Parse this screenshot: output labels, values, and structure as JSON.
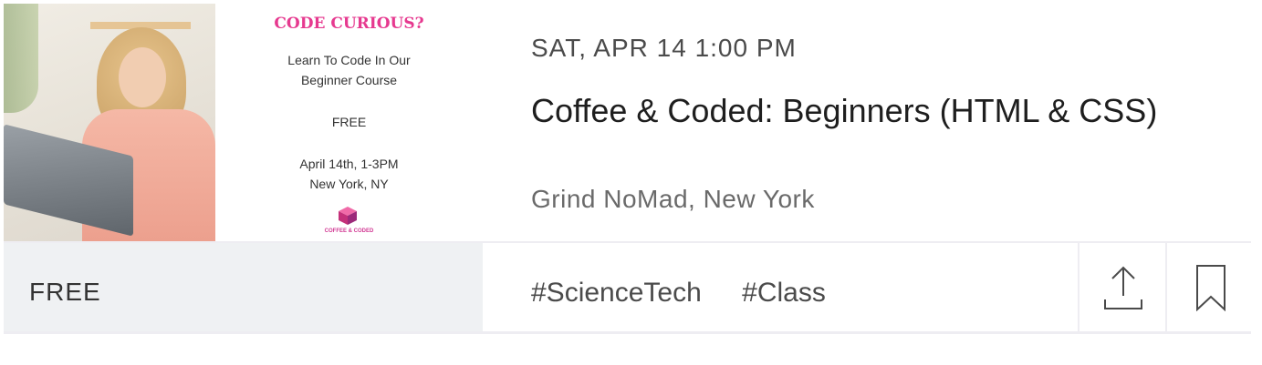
{
  "image": {
    "flyer_title": "CODE CURIOUS?",
    "flyer_line1": "Learn To Code In Our",
    "flyer_line2": "Beginner Course",
    "flyer_price": "FREE",
    "flyer_date": "April 14th, 1-3PM",
    "flyer_location": "New York, NY",
    "flyer_brand": "COFFEE & CODED"
  },
  "event": {
    "datetime": "SAT, APR 14 1:00 PM",
    "title": "Coffee & Coded: Beginners (HTML & CSS)",
    "venue": "Grind NoMad, New York"
  },
  "footer": {
    "price": "FREE",
    "tags": [
      "#ScienceTech",
      "#Class"
    ],
    "share_icon": "share-icon",
    "bookmark_icon": "bookmark-icon"
  },
  "colors": {
    "accent_pink": "#e6398f",
    "price_bg": "#eff1f3",
    "divider": "#eeedf2"
  }
}
